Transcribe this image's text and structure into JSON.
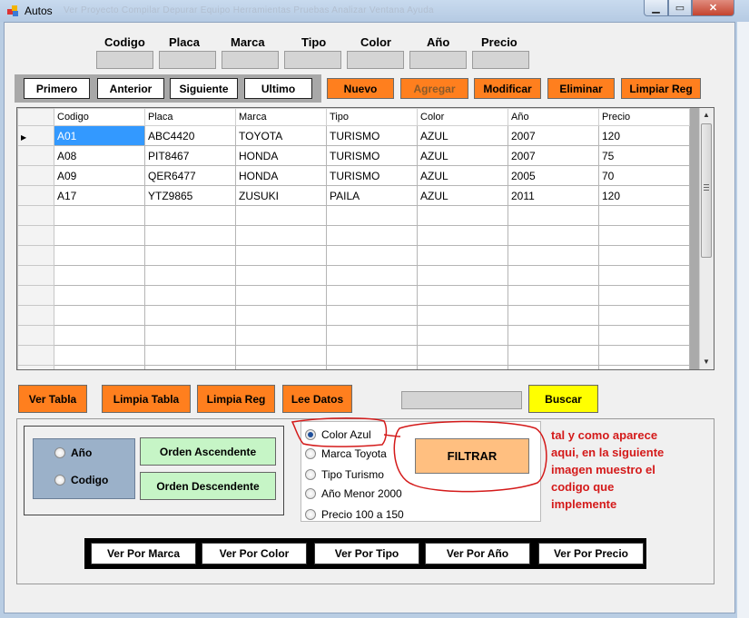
{
  "window": {
    "title": "Autos",
    "background_menu_text": "Ver    Proyecto    Compilar    Depurar    Equipo    Herramientas    Pruebas    Analizar    Ventana    Ayuda",
    "minimize_glyph": "▁",
    "maximize_glyph": "▭",
    "close_glyph": "✕"
  },
  "fields": {
    "headers": [
      "Codigo",
      "Placa",
      "Marca",
      "Tipo",
      "Color",
      "Año",
      "Precio"
    ]
  },
  "navigation": {
    "first": "Primero",
    "previous": "Anterior",
    "next": "Siguiente",
    "last": "Ultimo"
  },
  "actions": {
    "new": "Nuevo",
    "add": "Agregar",
    "modify": "Modificar",
    "delete": "Eliminar",
    "clear": "Limpiar Reg"
  },
  "grid": {
    "columns": [
      "Codigo",
      "Placa",
      "Marca",
      "Tipo",
      "Color",
      "Año",
      "Precio"
    ],
    "rows": [
      [
        "A01",
        "ABC4420",
        "TOYOTA",
        "TURISMO",
        "AZUL",
        "2007",
        "120"
      ],
      [
        "A08",
        "PIT8467",
        "HONDA",
        "TURISMO",
        "AZUL",
        "2007",
        "75"
      ],
      [
        "A09",
        "QER6477",
        "HONDA",
        "TURISMO",
        "AZUL",
        "2005",
        "70"
      ],
      [
        "A17",
        "YTZ9865",
        "ZUSUKI",
        "PAILA",
        "AZUL",
        "2011",
        "120"
      ]
    ],
    "current_row_indicator": "▶"
  },
  "toolbar2": {
    "view_table": "Ver Tabla",
    "clear_table": "Limpia Tabla",
    "clear_record": "Limpia Reg",
    "read_data": "Lee Datos",
    "search": "Buscar"
  },
  "ordering": {
    "radio_year": "Año",
    "radio_code": "Codigo",
    "ascending": "Orden Ascendente",
    "descending": "Orden Descendente"
  },
  "filters": {
    "options": [
      "Color Azul",
      "Marca Toyota",
      "Tipo Turismo",
      "Año Menor 2000",
      "Precio 100 a 150"
    ],
    "selected_index": 0,
    "filter_button": "FILTRAR"
  },
  "annotation": {
    "lines": [
      "tal y como aparece",
      "aqui, en la siguiente",
      "imagen muestro el",
      "codigo que",
      "implemente"
    ],
    "color": "#d41a1a"
  },
  "view_by": [
    "Ver Por Marca",
    "Ver Por Color",
    "Ver Por Tipo",
    "Ver Por Año",
    "Ver Por Precio"
  ],
  "colors": {
    "orange_button": "#ff7f1e",
    "green_button": "#c6f5c6",
    "yellow_button": "#ffff00",
    "filter_button": "#ffbf80",
    "selection": "#3399ff"
  }
}
